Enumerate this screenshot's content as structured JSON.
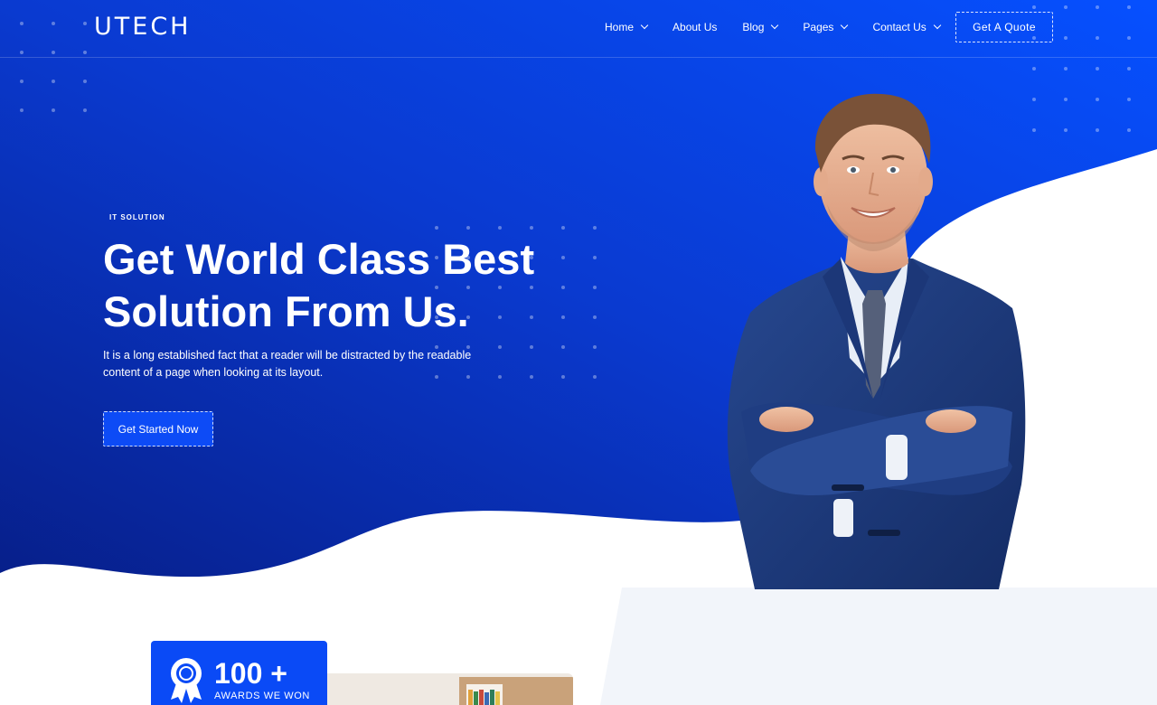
{
  "brand": {
    "logo": "UTECH"
  },
  "nav": {
    "items": [
      {
        "label": "Home",
        "has_dropdown": true
      },
      {
        "label": "About Us",
        "has_dropdown": false
      },
      {
        "label": "Blog",
        "has_dropdown": true
      },
      {
        "label": "Pages",
        "has_dropdown": true
      },
      {
        "label": "Contact Us",
        "has_dropdown": true
      }
    ],
    "quote_button": "Get A Quote"
  },
  "hero": {
    "eyebrow": "IT SOLUTION",
    "title_line1": "Get World Class Best",
    "title_line2": "Solution From Us.",
    "description": "It is a long established fact that a reader will be distracted by the readable content of a page when looking at its layout.",
    "cta": "Get Started Now"
  },
  "awards": {
    "number": "100 +",
    "label": "AWARDS WE WON"
  },
  "colors": {
    "primary": "#0a4af6",
    "hero_dark": "#0a2a9e",
    "hero_light": "#0a4af6",
    "panel_gray": "#f2f5fa"
  },
  "icons": [
    "chevron-down-icon",
    "award-ribbon-icon"
  ]
}
